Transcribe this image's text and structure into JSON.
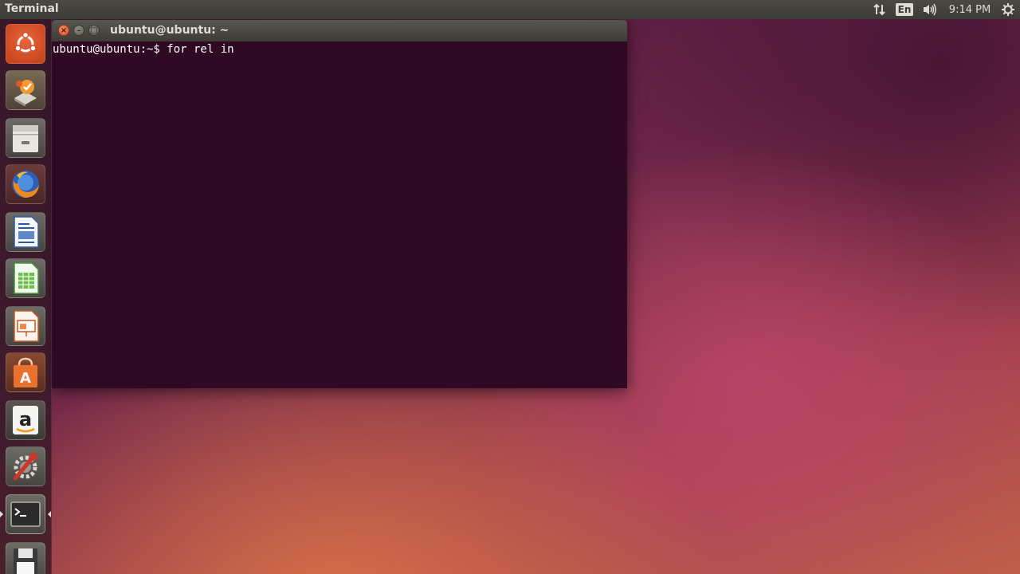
{
  "top_panel": {
    "app_title": "Terminal",
    "network_icon": "network-updown-icon",
    "keyboard_layout": "En",
    "sound_icon": "volume-icon",
    "clock": "9:14 PM",
    "settings_icon": "gear-icon"
  },
  "launcher": {
    "items": [
      {
        "name": "dash-home",
        "icon": "ubuntu-logo-icon"
      },
      {
        "name": "software-updater",
        "icon": "software-updater-icon"
      },
      {
        "name": "files",
        "icon": "file-cabinet-icon"
      },
      {
        "name": "firefox",
        "icon": "firefox-icon"
      },
      {
        "name": "libreoffice-writer",
        "icon": "writer-document-icon"
      },
      {
        "name": "libreoffice-calc",
        "icon": "calc-spreadsheet-icon"
      },
      {
        "name": "libreoffice-impress",
        "icon": "impress-presentation-icon"
      },
      {
        "name": "ubuntu-software-center",
        "icon": "shopping-bag-icon"
      },
      {
        "name": "amazon",
        "icon": "amazon-icon"
      },
      {
        "name": "system-settings",
        "icon": "wrench-gear-icon"
      },
      {
        "name": "terminal",
        "icon": "terminal-icon"
      },
      {
        "name": "save-device",
        "icon": "floppy-disk-icon"
      }
    ]
  },
  "terminal": {
    "window_title": "ubuntu@ubuntu: ~",
    "line": "ubuntu@ubuntu:~$ for rel in"
  },
  "colors": {
    "terminal_bg": "#300a24",
    "panel_bg": "#3c3b37",
    "close_button": "#e0501f"
  }
}
